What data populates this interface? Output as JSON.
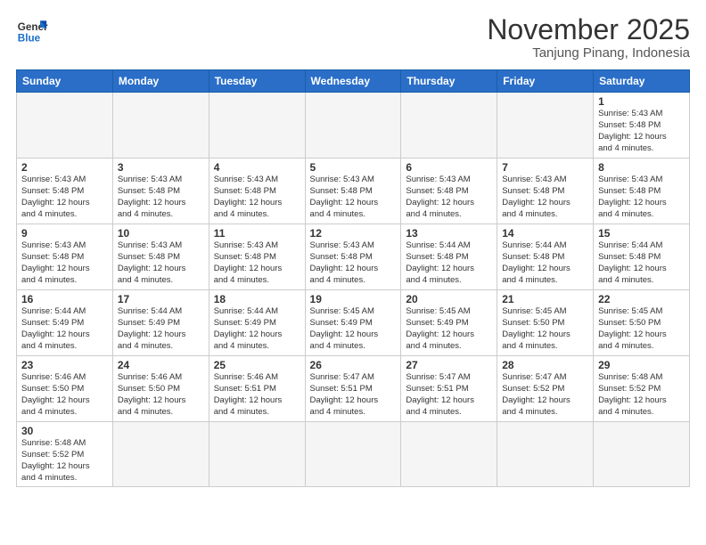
{
  "header": {
    "logo_general": "General",
    "logo_blue": "Blue",
    "title": "November 2025",
    "subtitle": "Tanjung Pinang, Indonesia"
  },
  "weekdays": [
    "Sunday",
    "Monday",
    "Tuesday",
    "Wednesday",
    "Thursday",
    "Friday",
    "Saturday"
  ],
  "weeks": [
    {
      "days": [
        {
          "num": "",
          "info": "",
          "empty": true
        },
        {
          "num": "",
          "info": "",
          "empty": true
        },
        {
          "num": "",
          "info": "",
          "empty": true
        },
        {
          "num": "",
          "info": "",
          "empty": true
        },
        {
          "num": "",
          "info": "",
          "empty": true
        },
        {
          "num": "",
          "info": "",
          "empty": true
        },
        {
          "num": "1",
          "info": "Sunrise: 5:43 AM\nSunset: 5:48 PM\nDaylight: 12 hours\nand 4 minutes.",
          "empty": false
        }
      ]
    },
    {
      "days": [
        {
          "num": "2",
          "info": "Sunrise: 5:43 AM\nSunset: 5:48 PM\nDaylight: 12 hours\nand 4 minutes.",
          "empty": false
        },
        {
          "num": "3",
          "info": "Sunrise: 5:43 AM\nSunset: 5:48 PM\nDaylight: 12 hours\nand 4 minutes.",
          "empty": false
        },
        {
          "num": "4",
          "info": "Sunrise: 5:43 AM\nSunset: 5:48 PM\nDaylight: 12 hours\nand 4 minutes.",
          "empty": false
        },
        {
          "num": "5",
          "info": "Sunrise: 5:43 AM\nSunset: 5:48 PM\nDaylight: 12 hours\nand 4 minutes.",
          "empty": false
        },
        {
          "num": "6",
          "info": "Sunrise: 5:43 AM\nSunset: 5:48 PM\nDaylight: 12 hours\nand 4 minutes.",
          "empty": false
        },
        {
          "num": "7",
          "info": "Sunrise: 5:43 AM\nSunset: 5:48 PM\nDaylight: 12 hours\nand 4 minutes.",
          "empty": false
        },
        {
          "num": "8",
          "info": "Sunrise: 5:43 AM\nSunset: 5:48 PM\nDaylight: 12 hours\nand 4 minutes.",
          "empty": false
        }
      ]
    },
    {
      "days": [
        {
          "num": "9",
          "info": "Sunrise: 5:43 AM\nSunset: 5:48 PM\nDaylight: 12 hours\nand 4 minutes.",
          "empty": false
        },
        {
          "num": "10",
          "info": "Sunrise: 5:43 AM\nSunset: 5:48 PM\nDaylight: 12 hours\nand 4 minutes.",
          "empty": false
        },
        {
          "num": "11",
          "info": "Sunrise: 5:43 AM\nSunset: 5:48 PM\nDaylight: 12 hours\nand 4 minutes.",
          "empty": false
        },
        {
          "num": "12",
          "info": "Sunrise: 5:43 AM\nSunset: 5:48 PM\nDaylight: 12 hours\nand 4 minutes.",
          "empty": false
        },
        {
          "num": "13",
          "info": "Sunrise: 5:44 AM\nSunset: 5:48 PM\nDaylight: 12 hours\nand 4 minutes.",
          "empty": false
        },
        {
          "num": "14",
          "info": "Sunrise: 5:44 AM\nSunset: 5:48 PM\nDaylight: 12 hours\nand 4 minutes.",
          "empty": false
        },
        {
          "num": "15",
          "info": "Sunrise: 5:44 AM\nSunset: 5:48 PM\nDaylight: 12 hours\nand 4 minutes.",
          "empty": false
        }
      ]
    },
    {
      "days": [
        {
          "num": "16",
          "info": "Sunrise: 5:44 AM\nSunset: 5:49 PM\nDaylight: 12 hours\nand 4 minutes.",
          "empty": false
        },
        {
          "num": "17",
          "info": "Sunrise: 5:44 AM\nSunset: 5:49 PM\nDaylight: 12 hours\nand 4 minutes.",
          "empty": false
        },
        {
          "num": "18",
          "info": "Sunrise: 5:44 AM\nSunset: 5:49 PM\nDaylight: 12 hours\nand 4 minutes.",
          "empty": false
        },
        {
          "num": "19",
          "info": "Sunrise: 5:45 AM\nSunset: 5:49 PM\nDaylight: 12 hours\nand 4 minutes.",
          "empty": false
        },
        {
          "num": "20",
          "info": "Sunrise: 5:45 AM\nSunset: 5:49 PM\nDaylight: 12 hours\nand 4 minutes.",
          "empty": false
        },
        {
          "num": "21",
          "info": "Sunrise: 5:45 AM\nSunset: 5:50 PM\nDaylight: 12 hours\nand 4 minutes.",
          "empty": false
        },
        {
          "num": "22",
          "info": "Sunrise: 5:45 AM\nSunset: 5:50 PM\nDaylight: 12 hours\nand 4 minutes.",
          "empty": false
        }
      ]
    },
    {
      "days": [
        {
          "num": "23",
          "info": "Sunrise: 5:46 AM\nSunset: 5:50 PM\nDaylight: 12 hours\nand 4 minutes.",
          "empty": false
        },
        {
          "num": "24",
          "info": "Sunrise: 5:46 AM\nSunset: 5:50 PM\nDaylight: 12 hours\nand 4 minutes.",
          "empty": false
        },
        {
          "num": "25",
          "info": "Sunrise: 5:46 AM\nSunset: 5:51 PM\nDaylight: 12 hours\nand 4 minutes.",
          "empty": false
        },
        {
          "num": "26",
          "info": "Sunrise: 5:47 AM\nSunset: 5:51 PM\nDaylight: 12 hours\nand 4 minutes.",
          "empty": false
        },
        {
          "num": "27",
          "info": "Sunrise: 5:47 AM\nSunset: 5:51 PM\nDaylight: 12 hours\nand 4 minutes.",
          "empty": false
        },
        {
          "num": "28",
          "info": "Sunrise: 5:47 AM\nSunset: 5:52 PM\nDaylight: 12 hours\nand 4 minutes.",
          "empty": false
        },
        {
          "num": "29",
          "info": "Sunrise: 5:48 AM\nSunset: 5:52 PM\nDaylight: 12 hours\nand 4 minutes.",
          "empty": false
        }
      ]
    },
    {
      "days": [
        {
          "num": "30",
          "info": "Sunrise: 5:48 AM\nSunset: 5:52 PM\nDaylight: 12 hours\nand 4 minutes.",
          "empty": false
        },
        {
          "num": "",
          "info": "",
          "empty": true
        },
        {
          "num": "",
          "info": "",
          "empty": true
        },
        {
          "num": "",
          "info": "",
          "empty": true
        },
        {
          "num": "",
          "info": "",
          "empty": true
        },
        {
          "num": "",
          "info": "",
          "empty": true
        },
        {
          "num": "",
          "info": "",
          "empty": true
        }
      ]
    }
  ]
}
